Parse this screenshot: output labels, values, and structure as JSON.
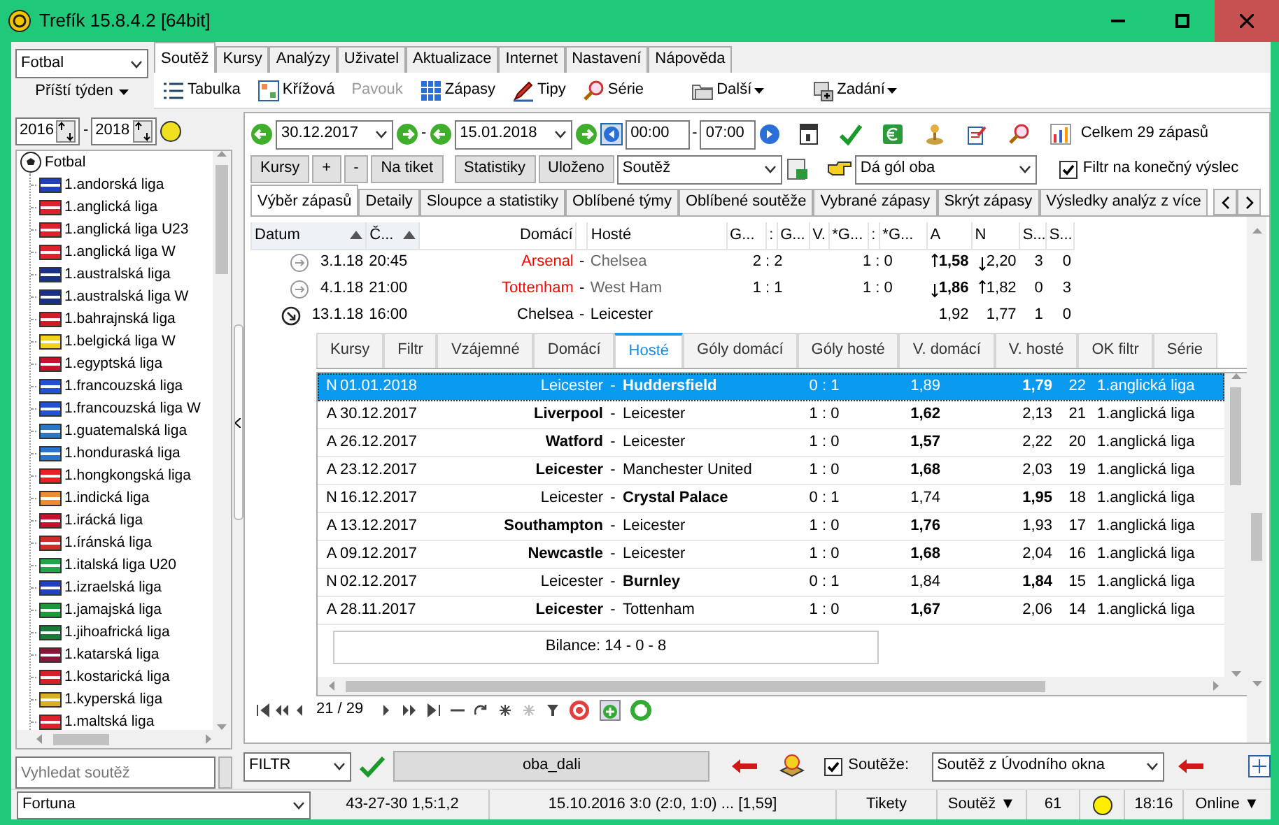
{
  "window": {
    "title": "Trefík 15.8.4.2 [64bit]"
  },
  "left": {
    "sport": "Fotbal",
    "period": "Příští týden",
    "year_from": "2016",
    "year_dash": "-",
    "year_to": "2018",
    "tree": [
      {
        "label": "Fotbal",
        "children": [
          {
            "label": "1.andorská liga",
            "color": "#1f3fbf"
          },
          {
            "label": "1.anglická liga",
            "color": "#e0202a"
          },
          {
            "label": "1.anglická liga U23",
            "color": "#e0202a"
          },
          {
            "label": "1.anglická liga W",
            "color": "#e0202a"
          },
          {
            "label": "1.australská liga",
            "color": "#1a2f8a"
          },
          {
            "label": "1.australská liga W",
            "color": "#1a2f8a"
          },
          {
            "label": "1.bahrajnská liga",
            "color": "#d01c28"
          },
          {
            "label": "1.belgická liga W",
            "color": "#f2d31a"
          },
          {
            "label": "1.egyptská liga",
            "color": "#c8102e"
          },
          {
            "label": "1.francouzská liga",
            "color": "#2350d8"
          },
          {
            "label": "1.francouzská liga W",
            "color": "#2350d8"
          },
          {
            "label": "1.guatemalská liga",
            "color": "#2a77c8"
          },
          {
            "label": "1.honduraská liga",
            "color": "#2a72d0"
          },
          {
            "label": "1.hongkongská liga",
            "color": "#ee1c25"
          },
          {
            "label": "1.indická liga",
            "color": "#f08c30"
          },
          {
            "label": "1.irácká liga",
            "color": "#c8102e"
          },
          {
            "label": "1.íránská liga",
            "color": "#d02a2a"
          },
          {
            "label": "1.italská liga U20",
            "color": "#1ea64a"
          },
          {
            "label": "1.izraelská liga",
            "color": "#2040c8"
          },
          {
            "label": "1.jamajská liga",
            "color": "#1a9a3a"
          },
          {
            "label": "1.jihoafrická liga",
            "color": "#1a7a3a"
          },
          {
            "label": "1.katarská liga",
            "color": "#8a1538"
          },
          {
            "label": "1.kostarická liga",
            "color": "#d8202a"
          },
          {
            "label": "1.kyperská liga",
            "color": "#d8b020"
          },
          {
            "label": "1.maltská liga",
            "color": "#e0202a"
          }
        ]
      }
    ],
    "search": {
      "placeholder": "Vyhledat soutěž"
    }
  },
  "menu_tabs": [
    {
      "label": "Soutěž",
      "selected": true
    },
    {
      "label": "Kursy",
      "selected": false
    },
    {
      "label": "Analýzy",
      "selected": false
    },
    {
      "label": "Uživatel",
      "selected": false
    },
    {
      "label": "Aktualizace",
      "selected": false
    },
    {
      "label": "Internet",
      "selected": false
    },
    {
      "label": "Nastavení",
      "selected": false
    },
    {
      "label": "Nápověda",
      "selected": false
    }
  ],
  "toolbar": [
    {
      "label": "Tabulka",
      "disabled": false,
      "dropdown": false
    },
    {
      "label": "Křížová",
      "disabled": false,
      "dropdown": false
    },
    {
      "label": "Pavouk",
      "disabled": true,
      "dropdown": false
    },
    {
      "label": "Zápasy",
      "disabled": false,
      "dropdown": false
    },
    {
      "label": "Tipy",
      "disabled": false,
      "dropdown": false
    },
    {
      "label": "Série",
      "disabled": false,
      "dropdown": false
    },
    {
      "label": "Další",
      "disabled": false,
      "dropdown": true
    },
    {
      "label": "Zadání",
      "disabled": false,
      "dropdown": true
    }
  ],
  "filter": {
    "date_from": "30.12.2017",
    "dash_1": "-",
    "date_to": "15.01.2018",
    "time_from": "00:00",
    "dash_2": "-",
    "time_to": "07:00",
    "total": "Celkem 29 zápasů",
    "buttons": [
      "Kursy",
      "+",
      "-",
      "Na tiket",
      "Statistiky",
      "Uloženo"
    ],
    "competition": "Soutěž",
    "condition": "Dá gól oba",
    "final_filter": {
      "label": "Filtr na konečný výslec",
      "checked": true
    }
  },
  "tabs": [
    {
      "label": "Výběr zápasů",
      "selected": true
    },
    {
      "label": "Detaily",
      "selected": false
    },
    {
      "label": "Sloupce a statistiky",
      "selected": false
    },
    {
      "label": "Oblíbené týmy",
      "selected": false
    },
    {
      "label": "Oblíbené soutěže",
      "selected": false
    },
    {
      "label": "Vybrané zápasy",
      "selected": false
    },
    {
      "label": "Skrýt zápasy",
      "selected": false
    },
    {
      "label": "Výsledky analýz z více",
      "selected": false
    }
  ],
  "table": {
    "columns": [
      {
        "label": "Datum",
        "sorted": true
      },
      {
        "label": "Č...",
        "sorted": true
      },
      {
        "label": "Domácí",
        "sorted": false
      },
      {
        "label": "Hosté",
        "sorted": false
      },
      {
        "label": "G...",
        "sorted": false
      },
      {
        "label": ":",
        "sorted": false
      },
      {
        "label": "G...",
        "sorted": false
      },
      {
        "label": "V.",
        "sorted": false
      },
      {
        "label": "*G...",
        "sorted": false
      },
      {
        "label": ":",
        "sorted": false
      },
      {
        "label": "*G...",
        "sorted": false
      },
      {
        "label": "A",
        "sorted": false
      },
      {
        "label": "N",
        "sorted": false
      },
      {
        "label": "S...",
        "sorted": false
      },
      {
        "label": "S...",
        "sorted": false
      }
    ],
    "rows": [
      {
        "kind": "finished",
        "date": "3.1.18",
        "time": "20:45",
        "home": "Arsenal",
        "sep": "-",
        "away": "Chelsea",
        "goals": "2 : 2",
        "half": "1 : 0",
        "a": "1,58",
        "a_rising": true,
        "n": "2,20",
        "n_rising": false,
        "s1": "3",
        "s2": "0"
      },
      {
        "kind": "finished",
        "date": "4.1.18",
        "time": "21:00",
        "home": "Tottenham",
        "sep": "-",
        "away": "West Ham",
        "goals": "1 : 1",
        "half": "1 : 0",
        "a": "1,86",
        "a_rising": false,
        "n": "1,82",
        "n_rising": true,
        "s1": "0",
        "s2": "3"
      },
      {
        "kind": "upcoming",
        "date": "13.1.18",
        "time": "16:00",
        "home": "Chelsea",
        "sep": "-",
        "away": "Leicester",
        "a": "1,92",
        "n": "1,77",
        "s1": "1",
        "s2": "0"
      }
    ]
  },
  "subtabs": [
    {
      "label": "Kursy",
      "selected": false
    },
    {
      "label": "Filtr",
      "selected": false
    },
    {
      "label": "Vzájemné",
      "selected": false
    },
    {
      "label": "Domácí",
      "selected": false
    },
    {
      "label": "Hosté",
      "selected": true
    },
    {
      "label": "Góly domácí",
      "selected": false
    },
    {
      "label": "Góly hosté",
      "selected": false
    },
    {
      "label": "V. domácí",
      "selected": false
    },
    {
      "label": "V. hosté",
      "selected": false
    },
    {
      "label": "OK filtr",
      "selected": false
    },
    {
      "label": "Série",
      "selected": false
    }
  ],
  "subtable": {
    "rows": [
      {
        "type": "N",
        "date": "01.01.2018",
        "home": "Leicester",
        "sep": "-",
        "away": "Huddersfield",
        "score": "0 : 1",
        "a": "1,89",
        "n": "1,79",
        "round": "22",
        "league": "1.anglická liga",
        "home_won": false,
        "selected": true
      },
      {
        "type": "A",
        "date": "30.12.2017",
        "home": "Liverpool",
        "sep": "-",
        "away": "Leicester",
        "score": "1 : 0",
        "a": "1,62",
        "n": "2,13",
        "round": "21",
        "league": "1.anglická liga",
        "home_won": true,
        "selected": false
      },
      {
        "type": "A",
        "date": "26.12.2017",
        "home": "Watford",
        "sep": "-",
        "away": "Leicester",
        "score": "1 : 0",
        "a": "1,57",
        "n": "2,22",
        "round": "20",
        "league": "1.anglická liga",
        "home_won": true,
        "selected": false
      },
      {
        "type": "A",
        "date": "23.12.2017",
        "home": "Leicester",
        "sep": "-",
        "away": "Manchester United",
        "score": "1 : 0",
        "a": "1,68",
        "n": "2,03",
        "round": "19",
        "league": "1.anglická liga",
        "home_won": true,
        "selected": false
      },
      {
        "type": "N",
        "date": "16.12.2017",
        "home": "Leicester",
        "sep": "-",
        "away": "Crystal Palace",
        "score": "0 : 1",
        "a": "1,74",
        "n": "1,95",
        "round": "18",
        "league": "1.anglická liga",
        "home_won": false,
        "selected": false
      },
      {
        "type": "A",
        "date": "13.12.2017",
        "home": "Southampton",
        "sep": "-",
        "away": "Leicester",
        "score": "1 : 0",
        "a": "1,76",
        "n": "1,93",
        "round": "17",
        "league": "1.anglická liga",
        "home_won": true,
        "selected": false
      },
      {
        "type": "A",
        "date": "09.12.2017",
        "home": "Newcastle",
        "sep": "-",
        "away": "Leicester",
        "score": "1 : 0",
        "a": "1,68",
        "n": "2,04",
        "round": "16",
        "league": "1.anglická liga",
        "home_won": true,
        "selected": false
      },
      {
        "type": "N",
        "date": "02.12.2017",
        "home": "Leicester",
        "sep": "-",
        "away": "Burnley",
        "score": "0 : 1",
        "a": "1,84",
        "n": "1,84",
        "round": "15",
        "league": "1.anglická liga",
        "home_won": false,
        "selected": false
      },
      {
        "type": "A",
        "date": "28.11.2017",
        "home": "Leicester",
        "sep": "-",
        "away": "Tottenham",
        "score": "1 : 0",
        "a": "1,67",
        "n": "2,06",
        "round": "14",
        "league": "1.anglická liga",
        "home_won": true,
        "selected": false
      }
    ],
    "balance": "Bilance: 14 - 0 - 8"
  },
  "navigator": {
    "position": "21 / 29"
  },
  "bottom": {
    "filter": "FILTR",
    "name": "oba_dali",
    "competitions": {
      "label": "Soutěže:",
      "checked": true
    },
    "source": "Soutěž z Úvodního okna"
  },
  "status_bar": [
    {
      "kind": "select",
      "text": "Fortuna"
    },
    {
      "kind": "text",
      "text": "43-27-30  1,5:1,2"
    },
    {
      "kind": "text",
      "text": "15.10.2016 3:0 (2:0, 1:0) ... [1,59]"
    },
    {
      "kind": "text",
      "text": "Tikety"
    },
    {
      "kind": "menu",
      "text": "Soutěž ▼"
    },
    {
      "kind": "text",
      "text": "61"
    },
    {
      "kind": "dot",
      "color": "#ffee00"
    },
    {
      "kind": "text",
      "text": "18:16"
    },
    {
      "kind": "menu",
      "text": "Online ▼"
    }
  ]
}
